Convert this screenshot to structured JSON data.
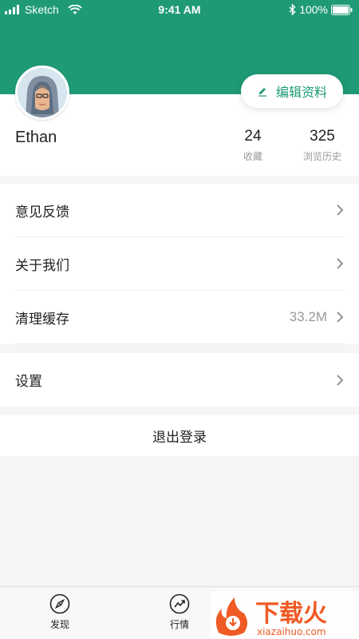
{
  "status_bar": {
    "carrier": "Sketch",
    "time": "9:41 AM",
    "battery": "100%"
  },
  "profile": {
    "username": "Ethan",
    "edit_label": "编辑资料",
    "stats": [
      {
        "value": "24",
        "label": "收藏"
      },
      {
        "value": "325",
        "label": "浏览历史"
      }
    ]
  },
  "menu_group_1": [
    {
      "label": "意见反馈",
      "value": ""
    },
    {
      "label": "关于我们",
      "value": ""
    },
    {
      "label": "清理缓存",
      "value": "33.2M"
    }
  ],
  "menu_group_2": [
    {
      "label": "设置",
      "value": ""
    }
  ],
  "logout_label": "退出登录",
  "tabbar": {
    "items": [
      {
        "label": "发现",
        "icon": "compass-icon"
      },
      {
        "label": "行情",
        "icon": "trend-icon"
      }
    ]
  },
  "watermark": {
    "brand": "下载火",
    "domain": "xiazaihuo.com"
  },
  "colors": {
    "accent": "#1f9a76",
    "watermark_orange": "#f05a24"
  }
}
